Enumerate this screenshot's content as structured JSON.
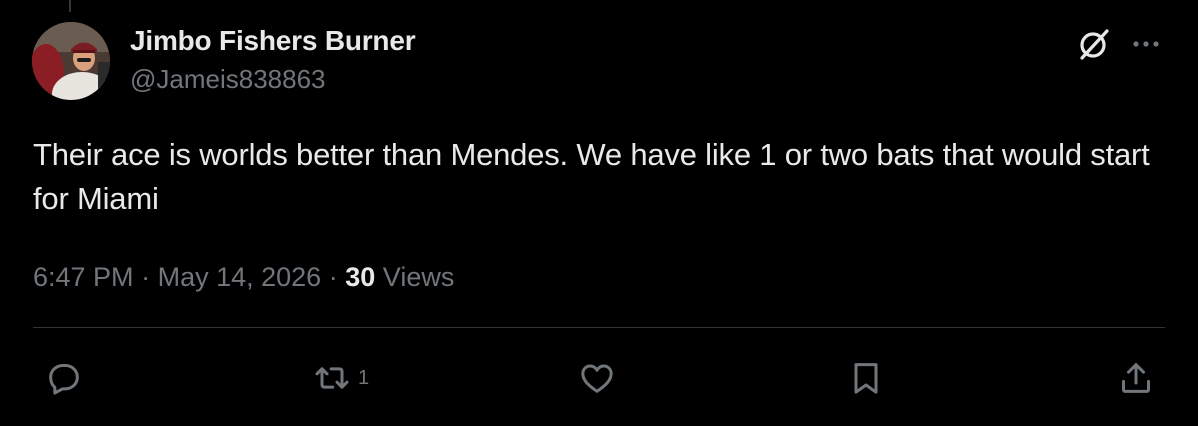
{
  "author": {
    "display_name": "Jimbo Fishers Burner",
    "handle": "@Jameis838863"
  },
  "icons": {
    "grok": "grok-slash-circle-icon",
    "more": "more-dots-icon",
    "reply": "reply-icon",
    "repost": "repost-icon",
    "like": "like-heart-icon",
    "bookmark": "bookmark-icon",
    "share": "share-icon"
  },
  "tweet": {
    "text": "Their ace is worlds better than Mendes. We have like 1 or two bats that would start for Miami",
    "time": "6:47 PM",
    "separator": "·",
    "date": "May 14, 2026",
    "views_count": "30",
    "views_label": "Views"
  },
  "actions": {
    "repost_count": "1"
  },
  "colors": {
    "background": "#000000",
    "primary_text": "#e7e9ea",
    "secondary_text": "#71767b",
    "divider": "#2f3336"
  }
}
